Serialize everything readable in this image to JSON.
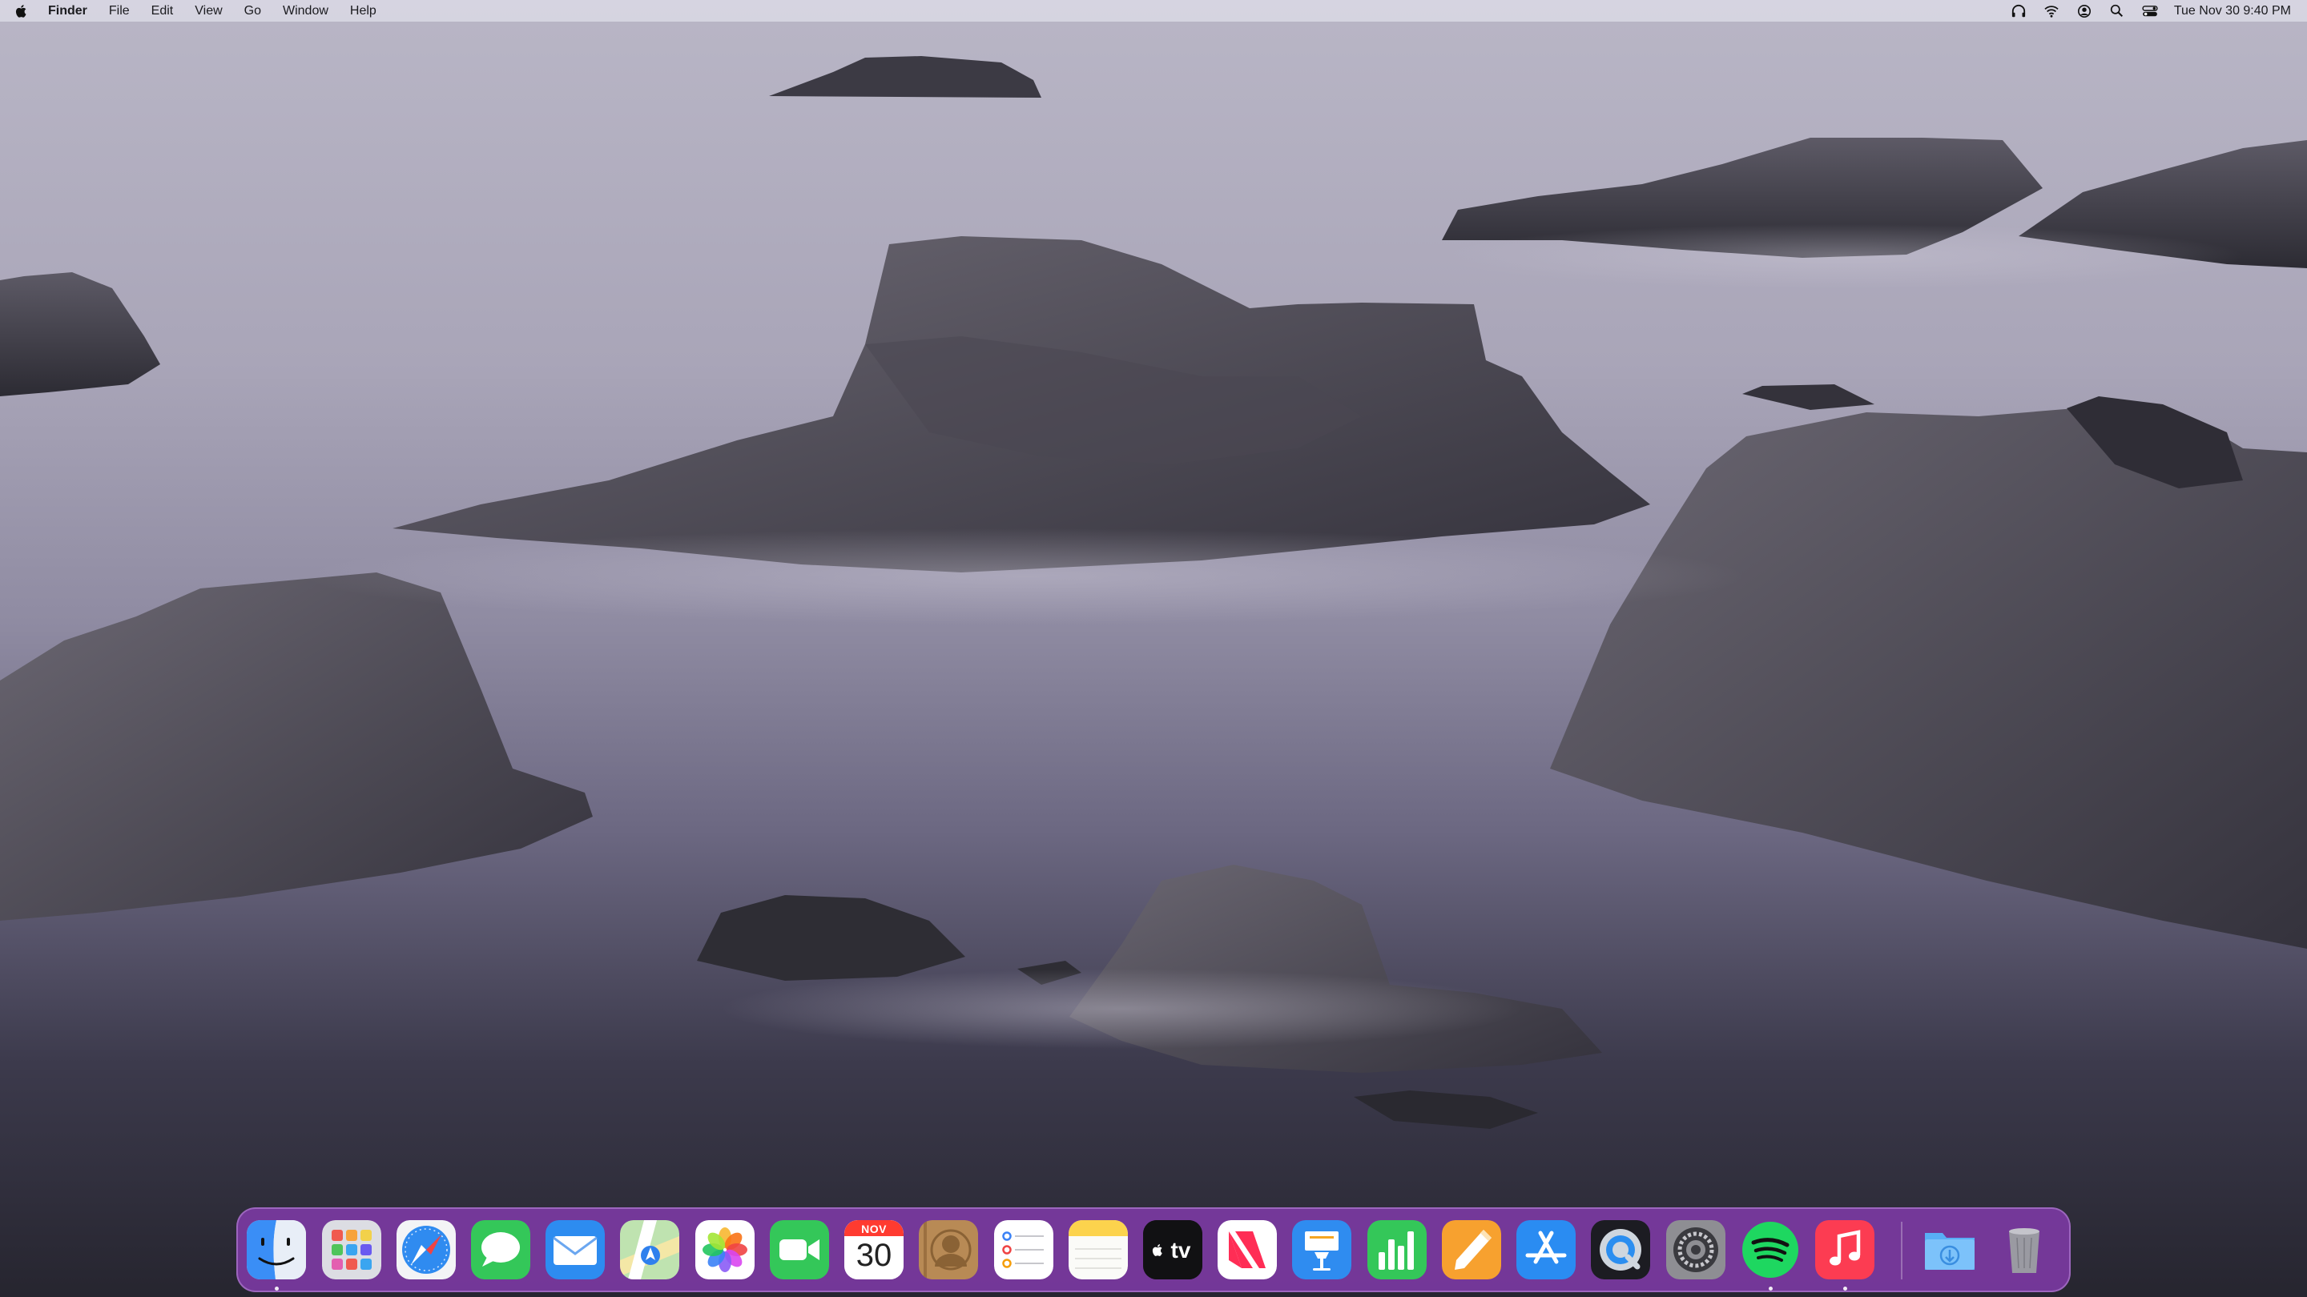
{
  "menubar": {
    "apple_icon": "apple-logo-icon",
    "app_name": "Finder",
    "menus": [
      "File",
      "Edit",
      "View",
      "Go",
      "Window",
      "Help"
    ],
    "status_icons": [
      "headphones-music-icon",
      "wifi-icon",
      "user-account-icon",
      "spotlight-search-icon",
      "control-center-icon"
    ],
    "clock": "Tue Nov 30  9:40 PM"
  },
  "dock": {
    "background_color": "#7e3aa6",
    "apps": [
      {
        "name": "Finder",
        "icon": "finder-icon",
        "running": true
      },
      {
        "name": "Launchpad",
        "icon": "launchpad-icon",
        "running": false
      },
      {
        "name": "Safari",
        "icon": "safari-compass-icon",
        "running": false
      },
      {
        "name": "Messages",
        "icon": "messages-bubble-icon",
        "running": false
      },
      {
        "name": "Mail",
        "icon": "mail-envelope-icon",
        "running": false
      },
      {
        "name": "Maps",
        "icon": "maps-icon",
        "running": false
      },
      {
        "name": "Photos",
        "icon": "photos-flower-icon",
        "running": false
      },
      {
        "name": "FaceTime",
        "icon": "facetime-camera-icon",
        "running": false
      },
      {
        "name": "Calendar",
        "icon": "calendar-icon",
        "running": false
      },
      {
        "name": "Contacts",
        "icon": "contacts-icon",
        "running": false
      },
      {
        "name": "Reminders",
        "icon": "reminders-list-icon",
        "running": false
      },
      {
        "name": "Notes",
        "icon": "notes-icon",
        "running": false
      },
      {
        "name": "TV",
        "icon": "apple-tv-icon",
        "running": false
      },
      {
        "name": "News",
        "icon": "news-icon",
        "running": false
      },
      {
        "name": "Keynote",
        "icon": "keynote-podium-icon",
        "running": false
      },
      {
        "name": "Numbers",
        "icon": "numbers-bar-chart-icon",
        "running": false
      },
      {
        "name": "Pages",
        "icon": "pages-pen-icon",
        "running": false
      },
      {
        "name": "App Store",
        "icon": "app-store-icon",
        "running": false
      },
      {
        "name": "QuickTime Player",
        "icon": "quicktime-icon",
        "running": false
      },
      {
        "name": "System Preferences",
        "icon": "system-preferences-gear-icon",
        "running": false
      },
      {
        "name": "Spotify",
        "icon": "spotify-icon",
        "running": true
      },
      {
        "name": "Music",
        "icon": "music-note-icon",
        "running": true
      }
    ],
    "calendar": {
      "month": "NOV",
      "day": "30"
    },
    "tv": {
      "label": "tv"
    },
    "downloads": {
      "name": "Downloads",
      "icon": "downloads-folder-icon"
    },
    "trash": {
      "name": "Trash",
      "icon": "trash-can-icon"
    }
  }
}
